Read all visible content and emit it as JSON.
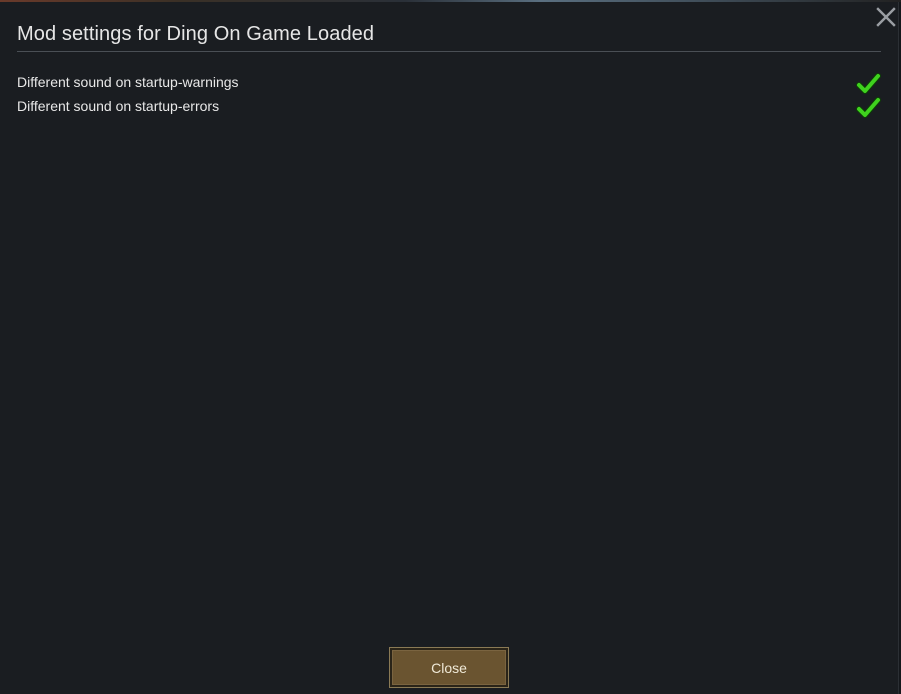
{
  "dialog": {
    "title": "Mod settings for Ding On Game Loaded",
    "close_icon": "close-x-icon"
  },
  "settings": [
    {
      "label": "Different sound on startup-warnings",
      "checked": true,
      "icon": "checkmark-icon"
    },
    {
      "label": "Different sound on startup-errors",
      "checked": true,
      "icon": "checkmark-icon"
    }
  ],
  "footer": {
    "close_label": "Close"
  },
  "colors": {
    "background": "#1a1d21",
    "check_green": "#3fd21e",
    "button_brown": "#6a5430",
    "text": "#e8e8e8"
  }
}
